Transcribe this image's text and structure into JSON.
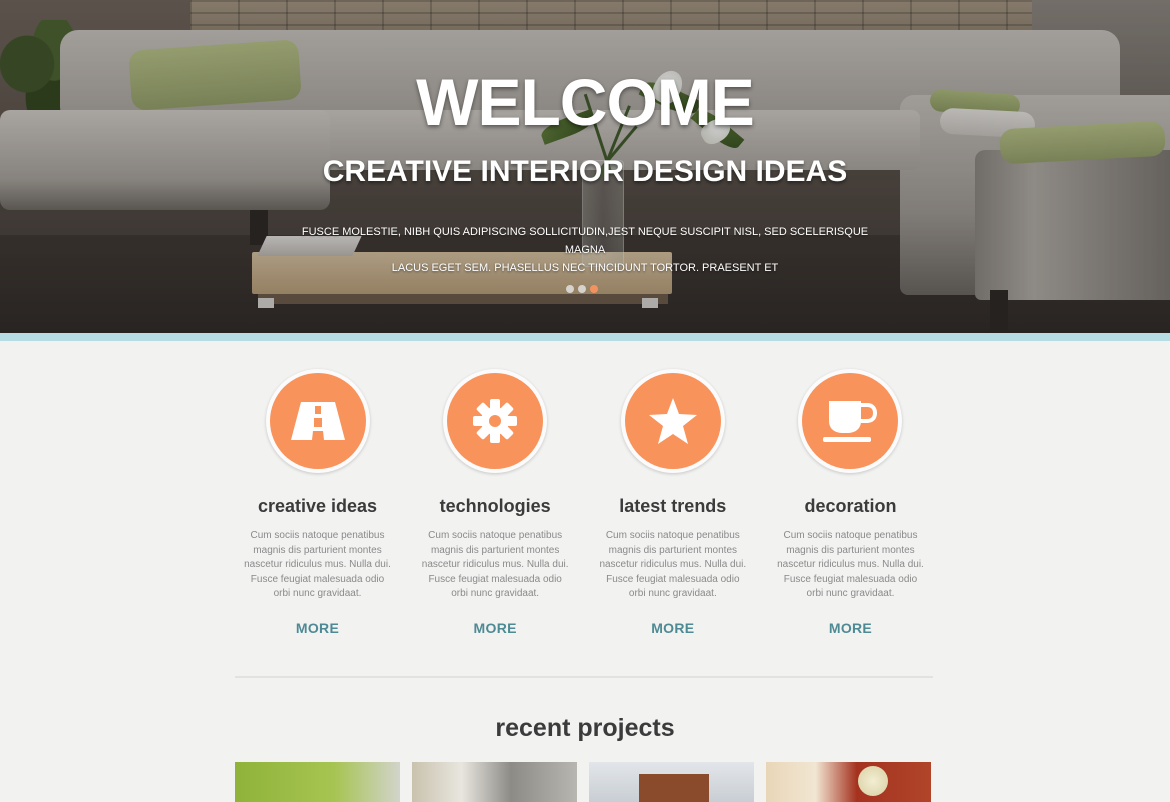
{
  "hero": {
    "title": "WELCOME",
    "subtitle": "CREATIVE INTERIOR DESIGN IDEAS",
    "text_line1": "FUSCE MOLESTIE, NIBH QUIS ADIPISCING SOLLICITUDIN,JEST NEQUE SUSCIPIT NISL, SED SCELERISQUE MAGNA",
    "text_line2": "LACUS EGET SEM. PHASELLUS NEC TINCIDUNT TORTOR. PRAESENT ET",
    "slider": {
      "count": 3,
      "active_index": 2
    }
  },
  "features": [
    {
      "icon": "road-icon",
      "title": "creative ideas",
      "text": "Cum sociis natoque penatibus magnis dis parturient montes nascetur ridiculus mus. Nulla dui. Fusce feugiat malesuada odio orbi nunc gravidaat.",
      "more": "MORE"
    },
    {
      "icon": "gear-icon",
      "title": "technologies",
      "text": "Cum sociis natoque penatibus magnis dis parturient montes nascetur ridiculus mus. Nulla dui. Fusce feugiat malesuada odio orbi nunc gravidaat.",
      "more": "MORE"
    },
    {
      "icon": "star-icon",
      "title": "latest trends",
      "text": "Cum sociis natoque penatibus magnis dis parturient montes nascetur ridiculus mus. Nulla dui. Fusce feugiat malesuada odio orbi nunc gravidaat.",
      "more": "MORE"
    },
    {
      "icon": "coffee-cup-icon",
      "title": "decoration",
      "text": "Cum sociis natoque penatibus magnis dis parturient montes nascetur ridiculus mus. Nulla dui. Fusce feugiat malesuada odio orbi nunc gravidaat.",
      "more": "MORE"
    }
  ],
  "projects": {
    "title": "recent projects"
  },
  "colors": {
    "accent_orange": "#f9935c",
    "link_teal": "#4e8a94",
    "stripe_blue": "#b5dde3",
    "background": "#f2f2f1"
  }
}
